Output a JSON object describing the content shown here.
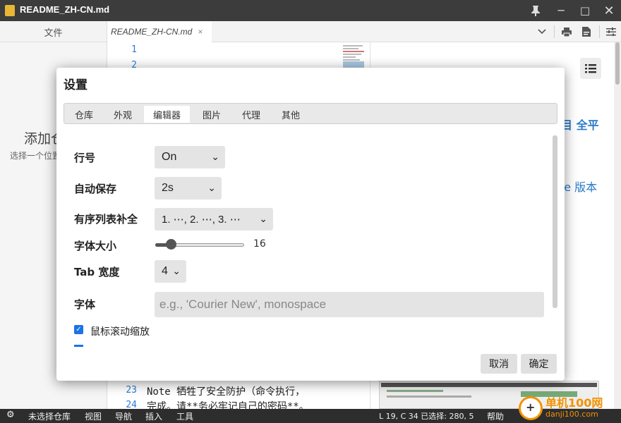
{
  "window": {
    "title": "README_ZH-CN.md"
  },
  "tabs": {
    "files_label": "文件",
    "doc_tab": "README_ZH-CN.md",
    "close": "×"
  },
  "sidebar": {
    "add_repo": "添加仓库",
    "hint": "选择一个位置"
  },
  "editor": {
    "lines": [
      {
        "num": "1",
        "text": ""
      },
      {
        "num": "2",
        "text": ""
      },
      {
        "num": "23",
        "text": "  Note 牺牲了安全防护（命令执行，"
      },
      {
        "num": "24",
        "text": "完成。请**务必牢记自己的密码**。"
      }
    ]
  },
  "preview": {
    "text1": "目 全平",
    "text2": "re 版本"
  },
  "settings": {
    "title": "设置",
    "tabs": [
      "仓库",
      "外观",
      "编辑器",
      "图片",
      "代理",
      "其他"
    ],
    "active_tab": "编辑器",
    "line_numbers": {
      "label": "行号",
      "value": "On"
    },
    "autosave": {
      "label": "自动保存",
      "value": "2s"
    },
    "ordered_list": {
      "label": "有序列表补全",
      "value": "1. ⋯, 2. ⋯, 3. ⋯"
    },
    "font_size": {
      "label": "字体大小",
      "value": "16"
    },
    "tab_width": {
      "label": "Tab 宽度",
      "value": "4"
    },
    "font": {
      "label": "字体",
      "placeholder": "e.g., 'Courier New', monospace"
    },
    "mouse_zoom": {
      "label": "鼠标滚动缩放",
      "checked": true
    },
    "cancel_label": "取消",
    "ok_label": "确定"
  },
  "status": {
    "no_repo": "未选择仓库",
    "view": "视图",
    "nav": "导航",
    "insert": "插入",
    "tools": "工具",
    "cursor": "L 19, C 34 已选择: 280, 5",
    "help": "帮助"
  },
  "watermark": {
    "cn": "单机100网",
    "url": "danji100.com"
  },
  "colors": {
    "accent": "#1a73e8",
    "link": "#2a79c9",
    "titlebar": "#3c3c3c",
    "statusbar": "#2d2d2d"
  }
}
